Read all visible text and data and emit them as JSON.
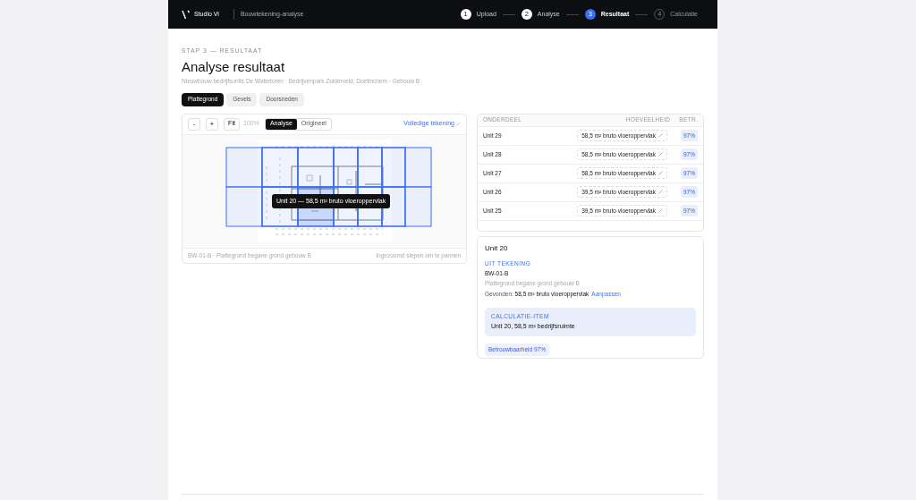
{
  "header": {
    "brand": "Studio Vi",
    "section": "Bouwtekening-analyse",
    "steps": [
      {
        "number": "1",
        "label": "Upload",
        "done": true,
        "current": false
      },
      {
        "number": "2",
        "label": "Analyse",
        "done": true,
        "current": false
      },
      {
        "number": "3",
        "label": "Resultaat",
        "done": false,
        "current": true
      },
      {
        "number": "4",
        "label": "Calculatie",
        "done": false,
        "current": false
      }
    ]
  },
  "eyebrow": "STAP 3 — RESULTAAT",
  "title": "Analyse resultaat",
  "subtitle": "Nieuwbouw bedrijfsunits De Watertoren · Bedrijvenpark Zuiderveld, Doetinchem · Gebouw B",
  "tabs": [
    {
      "label": "Plattegrond",
      "selected": true
    },
    {
      "label": "Gevels",
      "selected": false
    },
    {
      "label": "Doorsneden",
      "selected": false
    }
  ],
  "viewer": {
    "zoom_out": "-",
    "zoom_in": "+",
    "fit": "Fit",
    "zoom": "100%",
    "modes": [
      {
        "label": "Analyse",
        "selected": true
      },
      {
        "label": "Origineel",
        "selected": false
      }
    ],
    "full_link": "Volledige tekening",
    "units": [
      {
        "selected": false
      },
      {
        "selected": false
      },
      {
        "selected": false
      },
      {
        "selected": false
      },
      {
        "selected": false
      },
      {
        "selected": false
      },
      {
        "selected": false
      },
      {
        "selected": false
      },
      {
        "selected": false
      },
      {
        "selected": true
      },
      {
        "selected": false
      },
      {
        "selected": false
      },
      {
        "selected": false
      },
      {
        "selected": false
      }
    ],
    "tooltip": "Unit 20 — 58,5 m² bruto vloeroppervlak",
    "caption": "BW-01-B · Plattegrond begane grond gebouw B",
    "hint": "Ingezoomd slepen om te pannen"
  },
  "table": {
    "columns": [
      "ONDERDEEL",
      "HOEVEELHEID",
      "BETR."
    ],
    "rows": [
      {
        "part": "Unit 29",
        "quantity": "58,5 m² bruto vloeroppervlak",
        "confidence": "97%"
      },
      {
        "part": "Unit 28",
        "quantity": "58,5 m² bruto vloeroppervlak",
        "confidence": "97%"
      },
      {
        "part": "Unit 27",
        "quantity": "58,5 m² bruto vloeroppervlak",
        "confidence": "97%"
      },
      {
        "part": "Unit 26",
        "quantity": "39,5 m² bruto vloeroppervlak",
        "confidence": "97%"
      },
      {
        "part": "Unit 25",
        "quantity": "39,5 m² bruto vloeroppervlak",
        "confidence": "97%"
      }
    ]
  },
  "detail": {
    "title": "Unit 20",
    "source_label": "UIT TEKENING",
    "drawing_code": "BW-01-B",
    "drawing_name": "Plattegrond begane grond gebouw B",
    "found_label": "Gevonden:",
    "found_value": "58,5 m² bruto vloeroppervlak",
    "edit_link": "Aanpassen",
    "calc_label": "CALCULATIE-ITEM",
    "calc_value": "Unit 20, 58,5 m² bedrijfsruimte",
    "badge": "Betrouwbaarheid 97%"
  }
}
